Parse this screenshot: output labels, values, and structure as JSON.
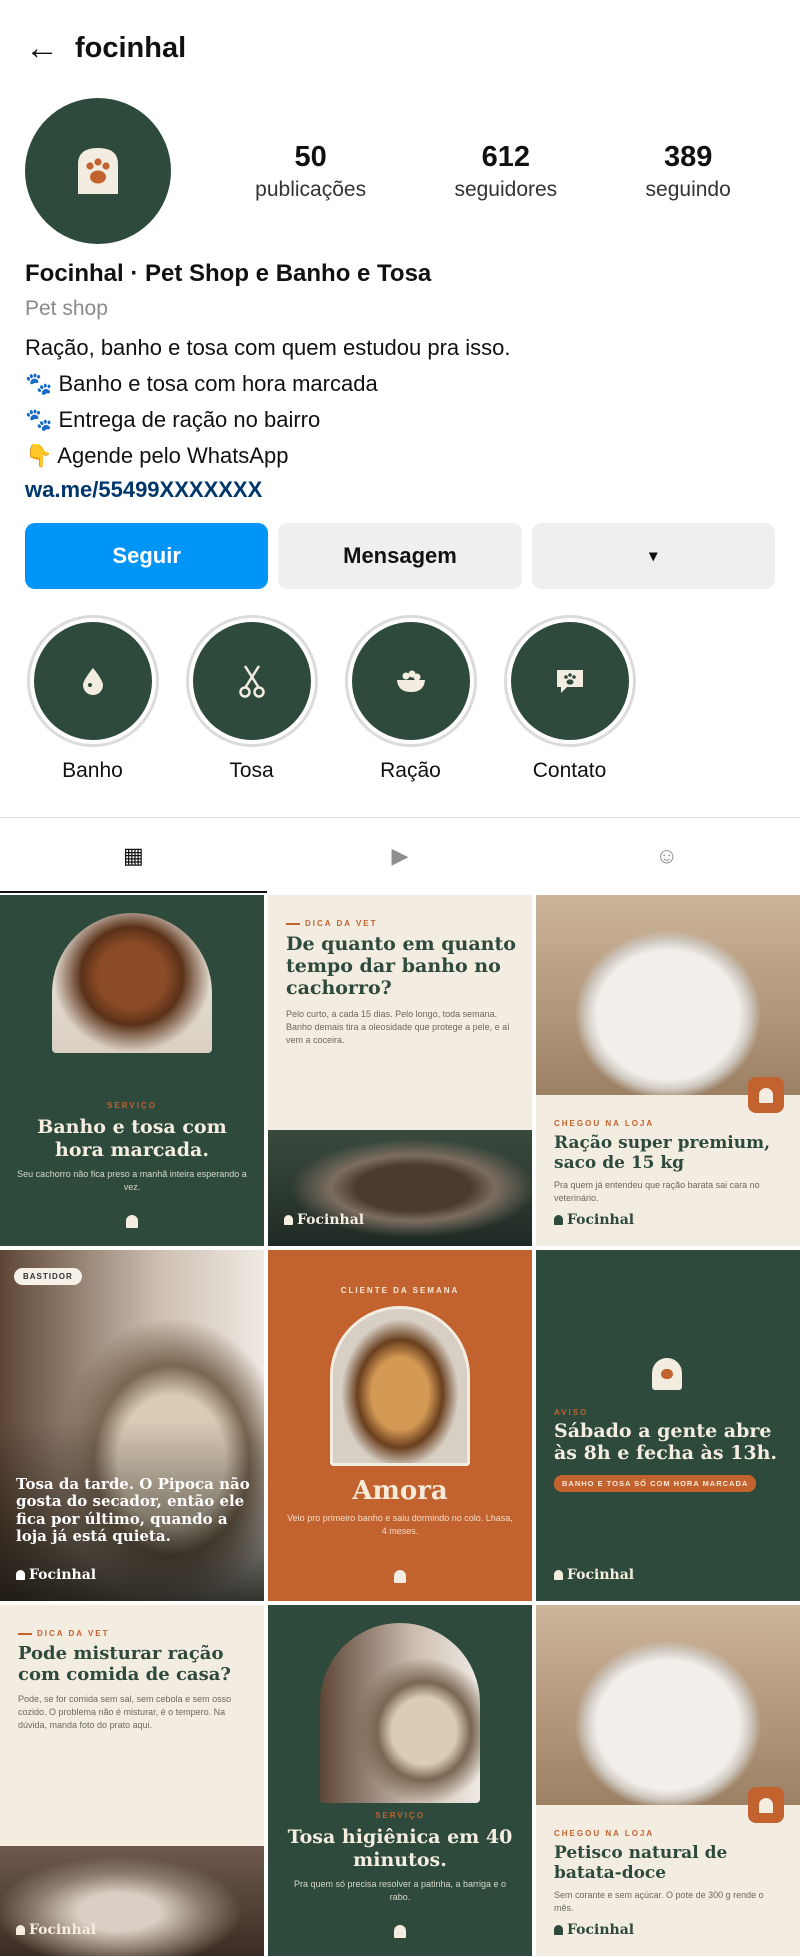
{
  "header": {
    "back_label": "←",
    "username": "focinhal"
  },
  "stats": [
    {
      "value": "50",
      "label": "publicações"
    },
    {
      "value": "612",
      "label": "seguidores"
    },
    {
      "value": "389",
      "label": "seguindo"
    }
  ],
  "bio": {
    "name": "Focinhal · Pet Shop e Banho e Tosa",
    "category": "Pet shop",
    "lines": [
      "Ração, banho e tosa com quem estudou pra isso.",
      "🐾 Banho e tosa com hora marcada",
      "🐾 Entrega de ração no bairro",
      "👇 Agende pelo WhatsApp"
    ],
    "link": "wa.me/55499XXXXXXX"
  },
  "actions": {
    "follow": "Seguir",
    "message": "Mensagem",
    "more": "▾"
  },
  "highlights": [
    {
      "label": "Banho",
      "icon": "drop-icon"
    },
    {
      "label": "Tosa",
      "icon": "scissors-icon"
    },
    {
      "label": "Ração",
      "icon": "food-bowl-icon"
    },
    {
      "label": "Contato",
      "icon": "chat-paw-icon"
    }
  ],
  "tabs": [
    {
      "icon": "grid-icon",
      "glyph": "▦"
    },
    {
      "icon": "reels-icon",
      "glyph": "▶"
    },
    {
      "icon": "tagged-icon",
      "glyph": "☺"
    }
  ],
  "posts": {
    "p1": {
      "kicker": "SERVIÇO",
      "title": "Banho e tosa com hora marcada.",
      "text": "Seu cachorro não fica preso a manhã inteira esperando a vez."
    },
    "p2": {
      "kicker": "DICA DA VET",
      "title": "De quanto em quanto tempo dar banho no cachorro?",
      "text": "Pelo curto, a cada 15 dias. Pelo longo, toda semana. Banho demais tira a oleosidade que protege a pele, e aí vem a coceira.",
      "brand": "Focinhal"
    },
    "p3": {
      "kicker": "CHEGOU NA LOJA",
      "title": "Ração super premium, saco de 15 kg",
      "text": "Pra quem já entendeu que ração barata sai cara no veterinário.",
      "brand": "Focinhal"
    },
    "p4": {
      "tag": "BASTIDOR",
      "title": "Tosa da tarde. O Pipoca não gosta do secador, então ele fica por último, quando a loja já está quieta.",
      "brand": "Focinhal"
    },
    "p5": {
      "kicker": "CLIENTE DA SEMANA",
      "title": "Amora",
      "text": "Veio pro primeiro banho e saiu dormindo no colo. Lhasa, 4 meses."
    },
    "p6": {
      "kicker": "AVISO",
      "title": "Sábado a gente abre às 8h e fecha às 13h.",
      "pill": "BANHO E TOSA SÓ COM HORA MARCADA",
      "brand": "Focinhal"
    },
    "p7": {
      "kicker": "DICA DA VET",
      "title": "Pode misturar ração com comida de casa?",
      "text": "Pode, se for comida sem sal, sem cebola e sem osso cozido. O problema não é misturar, é o tempero. Na dúvida, manda foto do prato aqui.",
      "brand": "Focinhal"
    },
    "p8": {
      "kicker": "SERVIÇO",
      "title": "Tosa higiênica em 40 minutos.",
      "text": "Pra quem só precisa resolver a patinha, a barriga e o rabo."
    },
    "p9": {
      "kicker": "CHEGOU NA LOJA",
      "title": "Petisco natural de batata-doce",
      "text": "Sem corante e sem açúcar. O pote de 300 g rende o mês.",
      "brand": "Focinhal"
    }
  },
  "colors": {
    "brand_green": "#2d4a3c",
    "brand_orange": "#c2622f",
    "cream": "#f3ece0",
    "follow_blue": "#0095f6"
  }
}
